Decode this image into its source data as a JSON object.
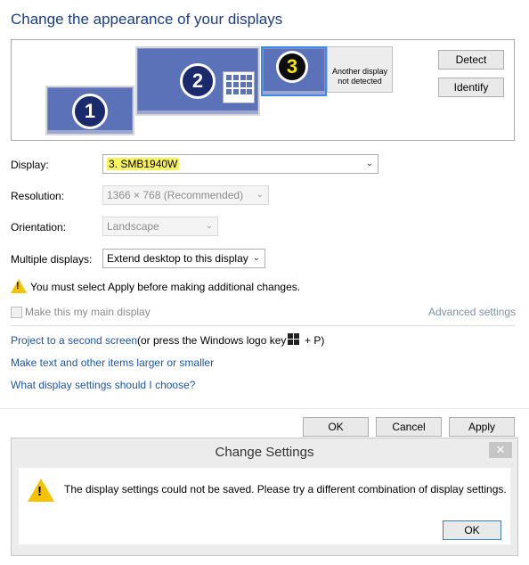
{
  "header": {
    "title": "Change the appearance of your displays"
  },
  "preview": {
    "monitors": [
      {
        "number": "1"
      },
      {
        "number": "2"
      },
      {
        "number": "3"
      }
    ],
    "not_detected_label": "Another display not detected",
    "detect_label": "Detect",
    "identify_label": "Identify"
  },
  "form": {
    "display_label": "Display:",
    "display_value": "3. SMB1940W",
    "resolution_label": "Resolution:",
    "resolution_value": "1366 × 768 (Recommended)",
    "orientation_label": "Orientation:",
    "orientation_value": "Landscape",
    "multiple_label": "Multiple displays:",
    "multiple_value": "Extend desktop to this display"
  },
  "warning": {
    "text": "You must select Apply before making additional changes."
  },
  "main_display": {
    "label": "Make this my main display",
    "checked": false
  },
  "advanced_link": "Advanced settings",
  "links": {
    "project_link": "Project to a second screen",
    "project_suffix_pre": "(or press the Windows logo key",
    "project_suffix_post": "+ P)",
    "text_size_link": "Make text and other items larger or smaller",
    "what_settings_link": "What display settings should I choose?"
  },
  "footer": {
    "ok": "OK",
    "cancel": "Cancel",
    "apply": "Apply"
  },
  "dialog": {
    "title": "Change Settings",
    "close": "✕",
    "message": "The display settings could not be saved. Please try a different combination of display settings.",
    "ok": "OK"
  },
  "colors": {
    "link": "#1b55b4",
    "title": "#193d8a",
    "highlight": "#f7f35d",
    "monitor": "#5b72b8"
  }
}
